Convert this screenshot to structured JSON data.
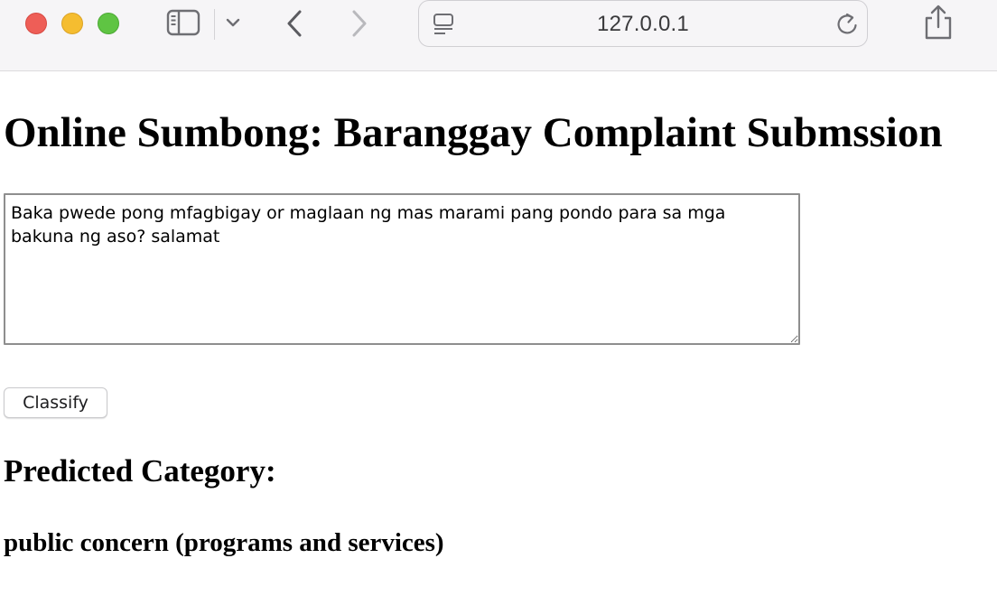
{
  "browser": {
    "address": "127.0.0.1",
    "icons": [
      "sidebar-icon",
      "chevron-down-icon",
      "back-icon",
      "forward-icon",
      "reader-icon",
      "reload-icon",
      "share-icon"
    ]
  },
  "page": {
    "title": "Online Sumbong: Baranggay Complaint Submssion",
    "complaint_text": "Baka pwede pong mfagbigay or maglaan ng mas marami pang pondo para sa mga bakuna ng aso? salamat",
    "classify_label": "Classify",
    "predicted_label": "Predicted Category:",
    "predicted_value": "public concern (programs and services)"
  }
}
